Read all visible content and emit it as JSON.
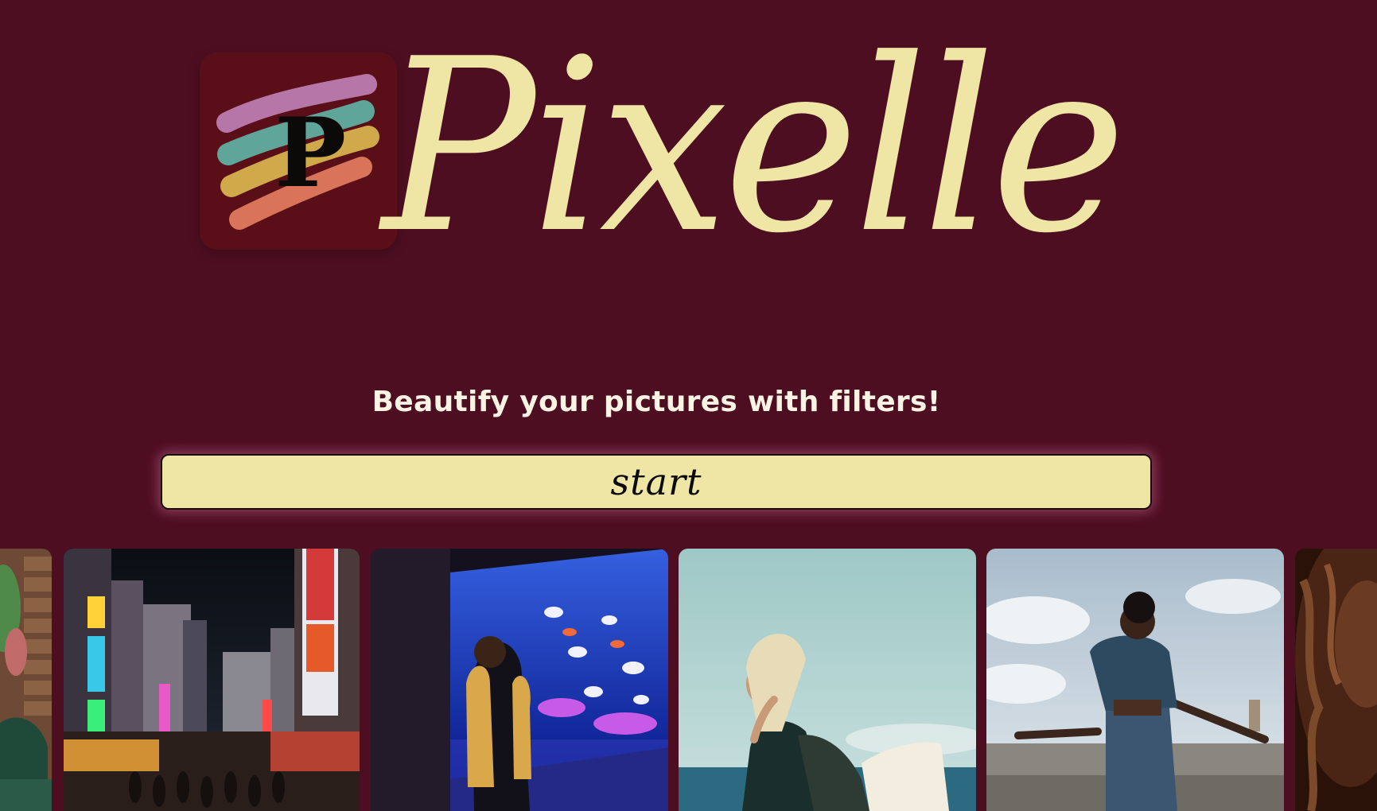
{
  "header": {
    "logo_letter": "P",
    "wordmark": "Pixelle"
  },
  "main": {
    "tagline": "Beautify your pictures with filters!",
    "start_label": "start"
  },
  "gallery": {
    "photos": [
      {
        "subject": "plant-wall"
      },
      {
        "subject": "city-street-night"
      },
      {
        "subject": "aquarium-visitor"
      },
      {
        "subject": "surfer-beach"
      },
      {
        "subject": "woman-ledge-sky"
      },
      {
        "subject": "curly-hair-portrait"
      }
    ]
  },
  "colors": {
    "background": "#4e0e22",
    "accent": "#efe6a6",
    "text": "#fbf3e4"
  }
}
